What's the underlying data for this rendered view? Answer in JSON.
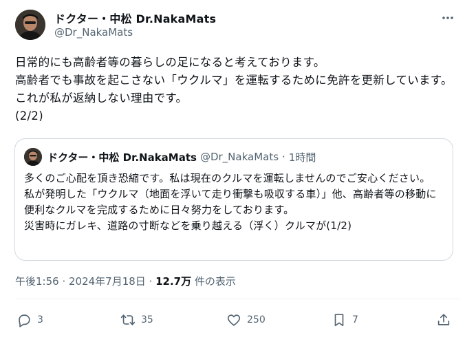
{
  "author": {
    "display_name": "ドクター・中松 Dr.NakaMats",
    "handle": "@Dr_NakaMats"
  },
  "tweet": {
    "lines": [
      "日常的にも高齢者等の暮らしの足になると考えております。",
      "高齢者でも事故を起こさない「ウクルマ」を運転するために免許を更新しています。これが私が返納しない理由です。",
      "(2/2)"
    ]
  },
  "quoted_tweet": {
    "display_name": "ドクター・中松 Dr.NakaMats",
    "handle": "@Dr_NakaMats",
    "separator": "·",
    "time": "1時間",
    "lines": [
      "多くのご心配を頂き恐縮です。私は現在のクルマを運転しませんのでご安心ください。",
      "私が発明した「ウクルマ（地面を浮いて走り衝撃も吸収する車）」他、高齢者等の移動に便利なクルマを完成するために日々努力をしております。",
      "災害時にガレキ、道路の寸断などを乗り越える（浮く）クルマが(1/2)"
    ]
  },
  "meta": {
    "timestamp": "午後1:56 · 2024年7月18日 · ",
    "views_count": "12.7万",
    "views_label": " 件の表示"
  },
  "actions": {
    "reply_count": "3",
    "retweet_count": "35",
    "like_count": "250",
    "bookmark_count": "7"
  },
  "icons": {
    "more": "more-dots-icon",
    "reply": "reply-bubble-icon",
    "retweet": "retweet-arrows-icon",
    "like": "heart-icon",
    "bookmark": "bookmark-icon",
    "share": "share-upload-icon"
  },
  "colors": {
    "text_primary": "#0f1419",
    "text_secondary": "#536471",
    "border": "#cfd9de"
  }
}
